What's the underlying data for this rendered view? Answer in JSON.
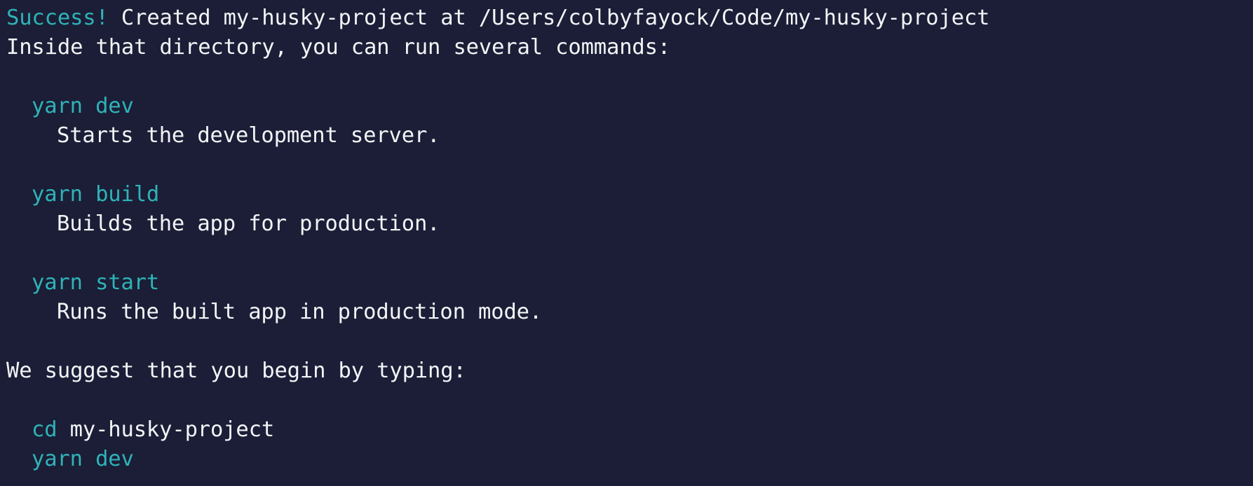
{
  "terminal": {
    "success_label": "Success!",
    "created_message": " Created my-husky-project at /Users/colbyfayock/Code/my-husky-project",
    "inside_message": "Inside that directory, you can run several commands:",
    "commands": [
      {
        "command": "yarn dev",
        "description": "Starts the development server."
      },
      {
        "command": "yarn build",
        "description": "Builds the app for production."
      },
      {
        "command": "yarn start",
        "description": "Runs the built app in production mode."
      }
    ],
    "suggest_message": "We suggest that you begin by typing:",
    "suggested": {
      "cd_keyword": "cd",
      "cd_target": " my-husky-project",
      "run_command": "yarn dev"
    }
  },
  "colors": {
    "background": "#1b1e36",
    "text": "#f3f4f7",
    "accent": "#2fb3b8"
  }
}
